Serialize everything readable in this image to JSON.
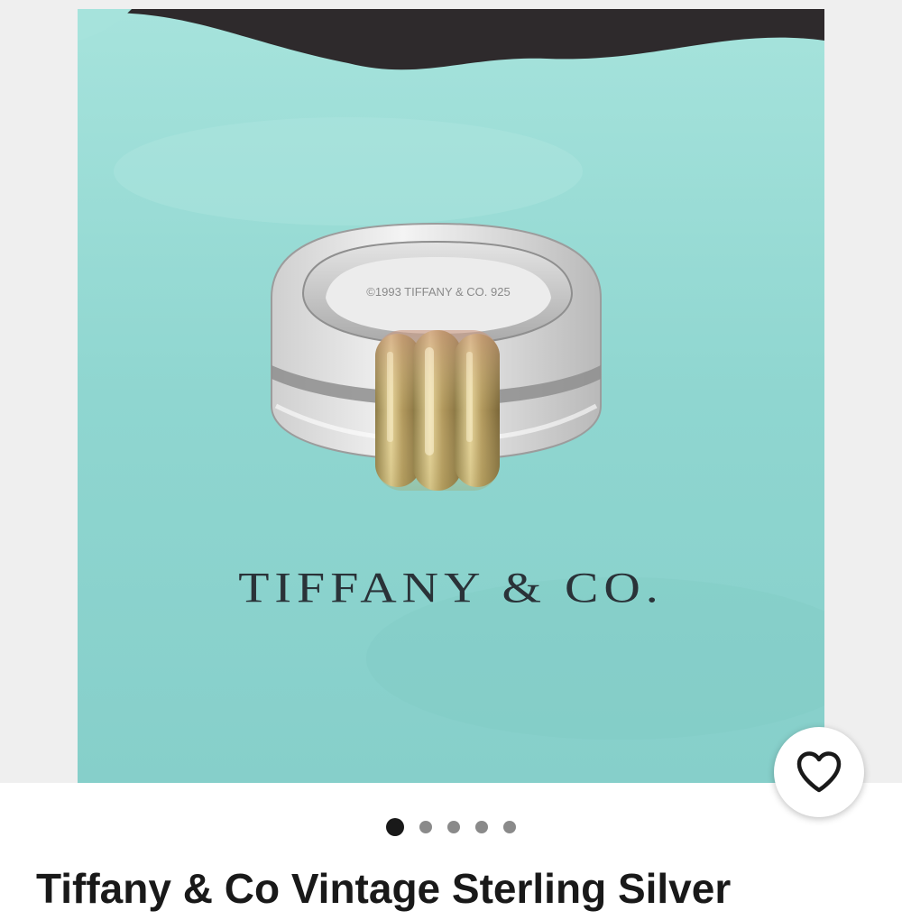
{
  "product": {
    "image": {
      "alt": "Tiffany & Co silver and gold ring on Tiffany blue pouch",
      "engraving_text": "©1993 TIFFANY & CO. 925",
      "brand_print": "TIFFANY & CO."
    },
    "favorite": {
      "icon": "heart-icon",
      "selected": false
    },
    "gallery": {
      "total_images": 5,
      "active_index": 0
    },
    "title": "Tiffany & Co Vintage Sterling Silver"
  },
  "colors": {
    "pouch": "#8fd9d4",
    "accent_dot": "#191919",
    "inactive_dot": "#8a8a8a"
  }
}
